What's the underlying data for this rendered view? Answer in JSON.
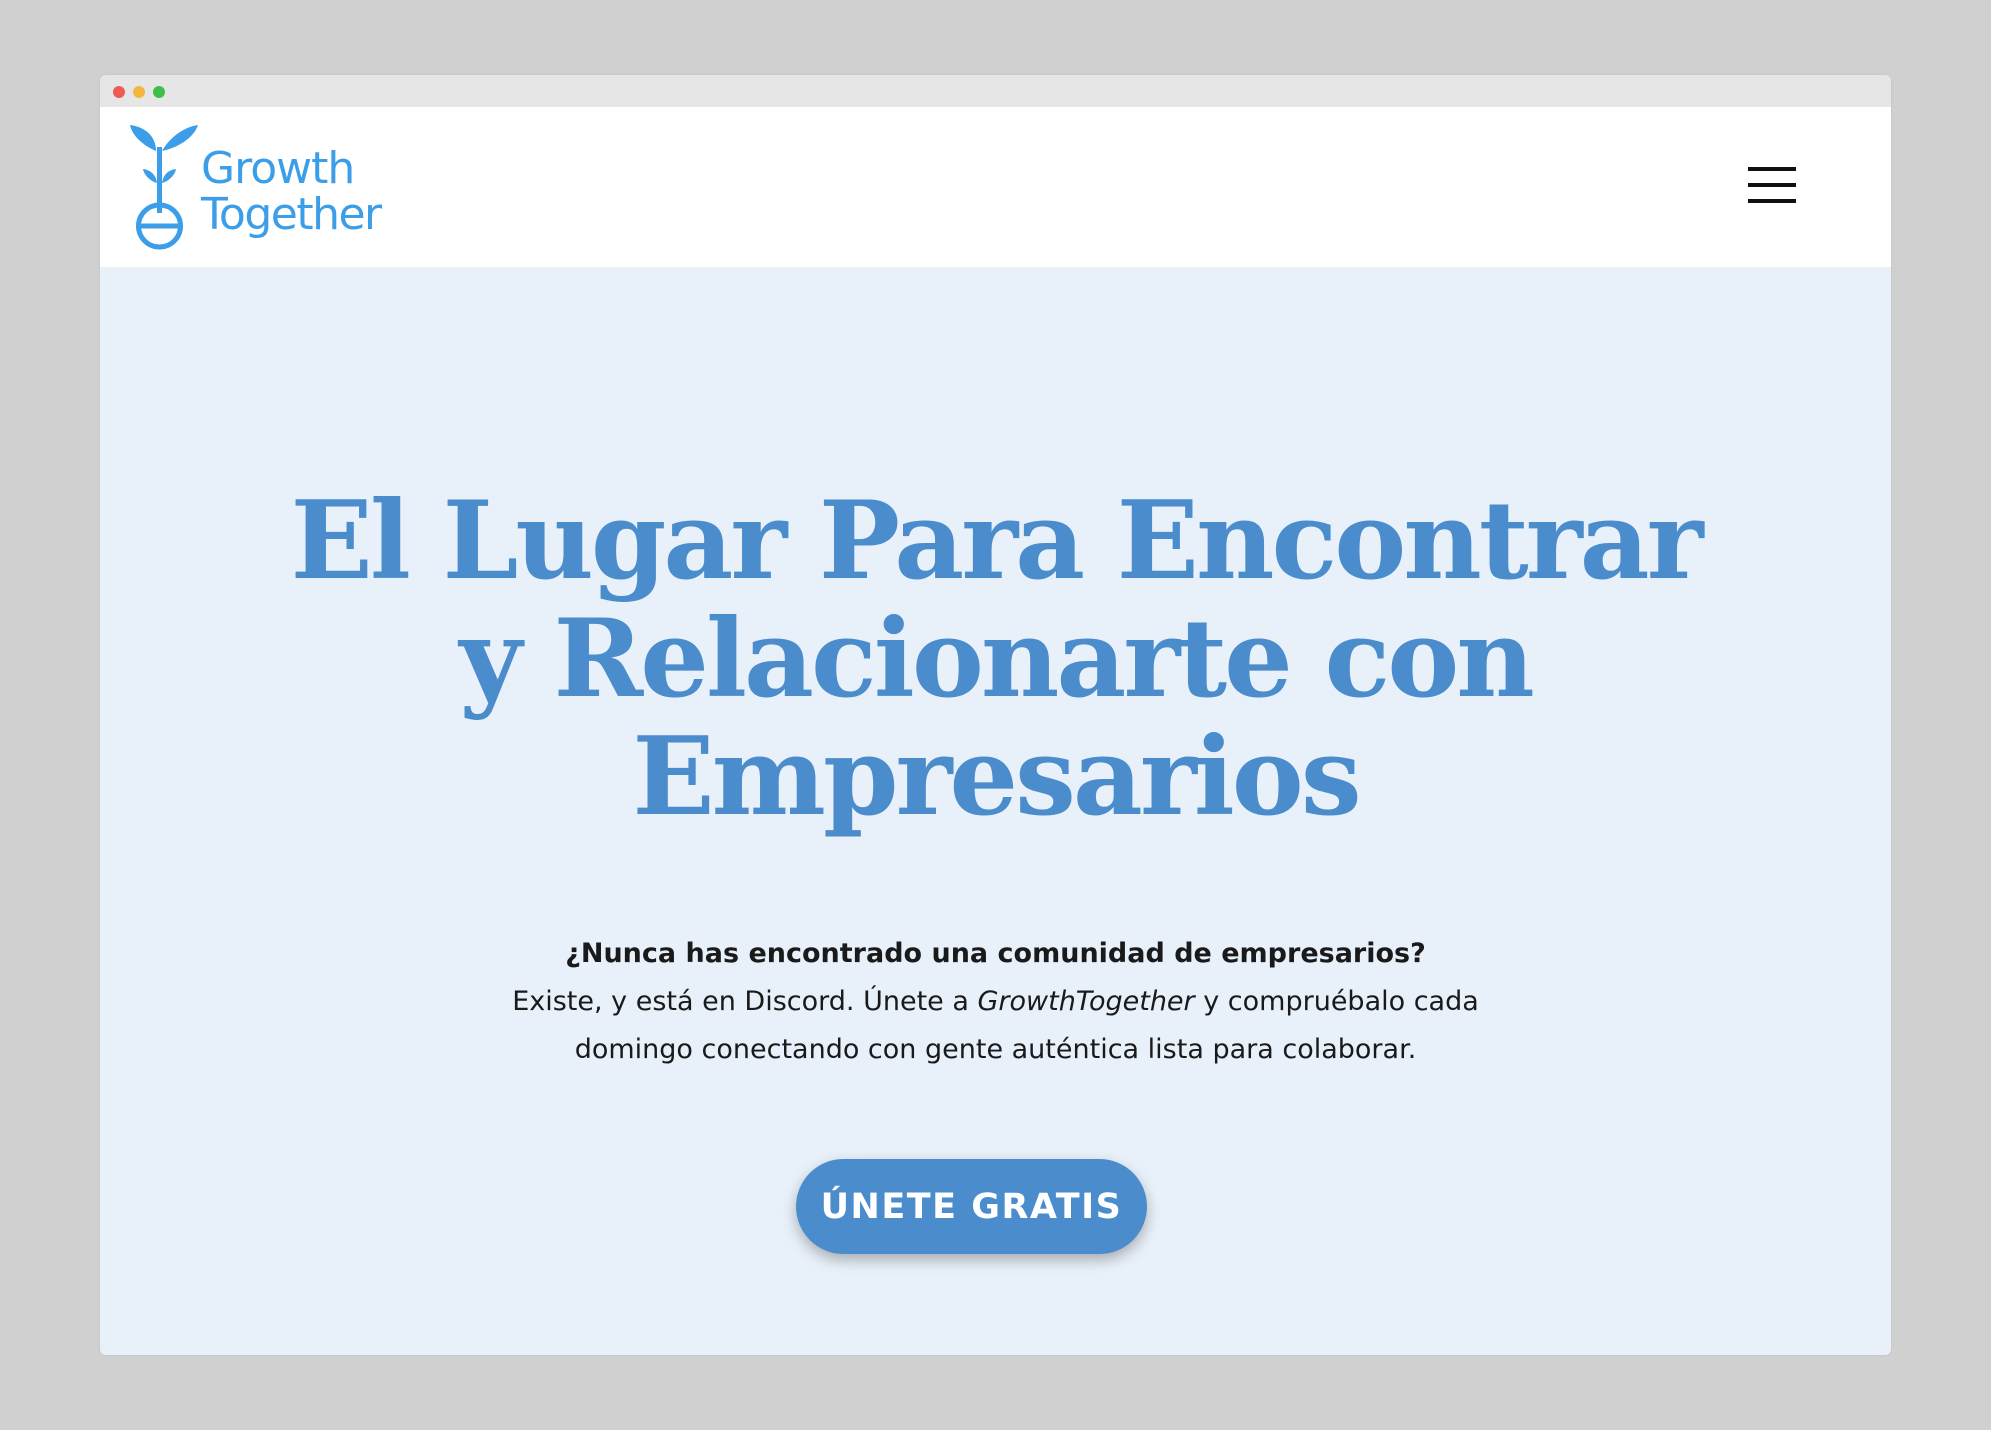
{
  "brand": {
    "name_line1": "Growth",
    "name_line2": "Together",
    "logo_icon": "sprout-icon",
    "color": "#3c9ee8"
  },
  "header": {
    "menu_icon": "hamburger-menu-icon"
  },
  "hero": {
    "title_lines": [
      "El Lugar Para Encontrar",
      "y Relacionarte con",
      "Empresarios"
    ],
    "question": "¿Nunca has encontrado una comunidad de empresarios?",
    "body_part1": "Existe, y está en Discord. Únete a ",
    "body_brand": "GrowthTogether",
    "body_part2": " y compruébalo cada",
    "body_line2": "domingo conectando con gente auténtica lista para colaborar.",
    "cta_label": "ÚNETE GRATIS",
    "accent_color": "#4a8ccc",
    "background_color": "#e8f0f9"
  }
}
